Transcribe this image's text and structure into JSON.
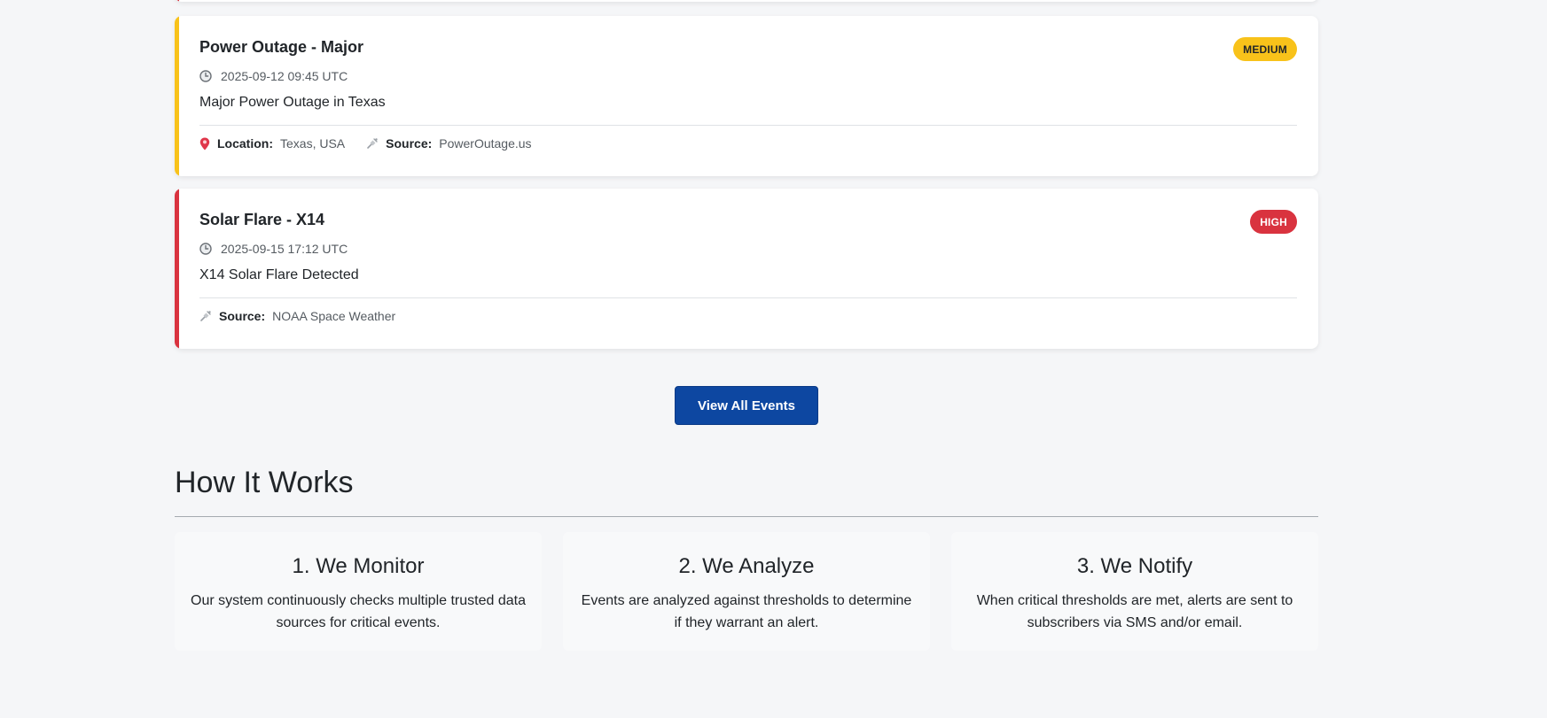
{
  "events": [
    {
      "title": "Power Outage - Major",
      "severity": "MEDIUM",
      "time": "2025-09-12 09:45 UTC",
      "description": "Major Power Outage in Texas",
      "location_label": "Location:",
      "location": "Texas, USA",
      "source_label": "Source:",
      "source": "PowerOutage.us"
    },
    {
      "title": "Solar Flare - X14",
      "severity": "HIGH",
      "time": "2025-09-15 17:12 UTC",
      "description": "X14 Solar Flare Detected",
      "source_label": "Source:",
      "source": "NOAA Space Weather"
    }
  ],
  "view_all_label": "View All Events",
  "how_it_works": {
    "title": "How It Works",
    "steps": [
      {
        "title": "1. We Monitor",
        "text": "Our system continuously checks multiple trusted data sources for critical events."
      },
      {
        "title": "2. We Analyze",
        "text": "Events are analyzed against thresholds to determine if they warrant an alert."
      },
      {
        "title": "3. We Notify",
        "text": "When critical thresholds are met, alerts are sent to subscribers via SMS and/or email."
      }
    ]
  },
  "colors": {
    "medium": "#f8c21a",
    "high": "#d9333f",
    "primary_button": "#0d47a1"
  },
  "icons": {
    "time": "clock-icon",
    "location": "map-pin-icon",
    "source": "satellite-icon"
  }
}
